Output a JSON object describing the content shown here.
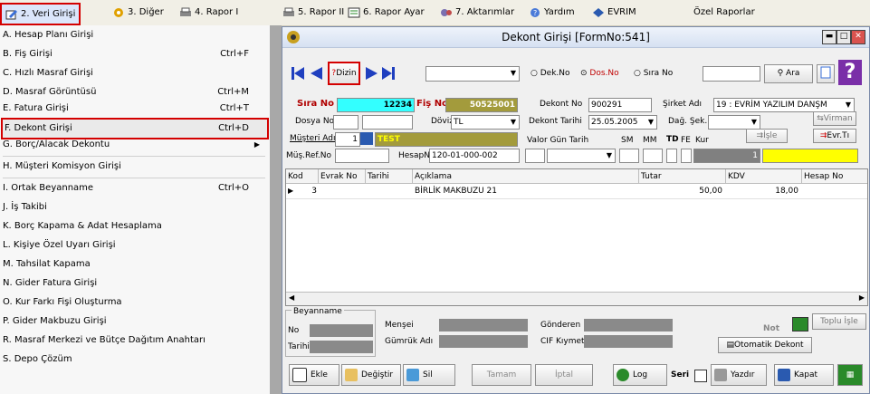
{
  "menubar": {
    "items": [
      {
        "label": "2. Veri Girişi"
      },
      {
        "label": "3. Diğer"
      },
      {
        "label": "4. Rapor I"
      },
      {
        "label": "5. Rapor II"
      },
      {
        "label": "6. Rapor Ayar"
      },
      {
        "label": "7. Aktarımlar"
      },
      {
        "label": "Yardım"
      },
      {
        "label": "EVRIM"
      },
      {
        "label": "Özel Raporlar"
      }
    ]
  },
  "dropdown": {
    "items": [
      {
        "label": "A. Hesap Planı Girişi",
        "shortcut": ""
      },
      {
        "label": "B. Fiş Girişi",
        "shortcut": "Ctrl+F"
      },
      {
        "label": "C. Hızlı Masraf Girişi",
        "shortcut": ""
      },
      {
        "label": "D. Masraf Görüntüsü",
        "shortcut": "Ctrl+M"
      },
      {
        "label": "E. Fatura Girişi",
        "shortcut": "Ctrl+T"
      },
      {
        "label": "F. Dekont Girişi",
        "shortcut": "Ctrl+D"
      },
      {
        "label": "G. Borç/Alacak Dekontu",
        "shortcut": ""
      },
      {
        "label": "H. Müşteri Komisyon Girişi",
        "shortcut": ""
      },
      {
        "label": "I. Ortak Beyanname",
        "shortcut": "Ctrl+O"
      },
      {
        "label": "J. İş Takibi",
        "shortcut": ""
      },
      {
        "label": "K. Borç Kapama & Adat Hesaplama",
        "shortcut": ""
      },
      {
        "label": "L. Kişiye Özel Uyarı Girişi",
        "shortcut": ""
      },
      {
        "label": "M. Tahsilat Kapama",
        "shortcut": ""
      },
      {
        "label": "N. Gider Fatura Girişi",
        "shortcut": ""
      },
      {
        "label": "O. Kur Farkı Fişi Oluşturma",
        "shortcut": ""
      },
      {
        "label": "P. Gider Makbuzu Girişi",
        "shortcut": ""
      },
      {
        "label": "R. Masraf Merkezi ve Bütçe Dağıtım Anahtarı",
        "shortcut": ""
      },
      {
        "label": "S. Depo Çözüm",
        "shortcut": ""
      }
    ]
  },
  "window": {
    "title": "Dekont Girişi [FormNo:541]",
    "toolbar": {
      "dizin_label": "Dizin",
      "dizin_prefix": "?",
      "radio_dek": "Dek.No",
      "radio_dos": "Dos.No",
      "radio_sira": "Sıra No",
      "ara_label": "Ara",
      "selected_radio": "Dos.No"
    },
    "form": {
      "sira_no_label": "Sıra No",
      "sira_no_value": "12234",
      "fis_no_label": "Fiş No",
      "fis_no_value": "50525001",
      "dekont_no_label": "Dekont No",
      "dekont_no_value": "900291",
      "sirket_adi_label": "Şirket Adı",
      "sirket_adi_value": "19 : EVRİM YAZILIM DANŞM",
      "dosya_no_label": "Dosya No",
      "doviz_label": "Döviz",
      "doviz_value": "TL",
      "dekont_tarihi_label": "Dekont Tarihi",
      "dekont_tarihi_value": "25.05.2005",
      "dag_sek_label": "Dağ. Şek.",
      "virman_label": "Virman",
      "musteri_adi_label": "Müşteri Adı",
      "musteri_no_value": "1",
      "musteri_name_value": "TEST",
      "valor_label": "Valor Gün Tarih",
      "sm_label": "SM",
      "mm_label": "MM",
      "td_label": "TD",
      "fe_label": "FE",
      "kur_label": "Kur",
      "kur_value": "1",
      "isle_label": "İşle",
      "evr_label": "Evr.Tı",
      "mus_ref_label": "Müş.Ref.No",
      "hesap_no_label": "HesapNo",
      "hesap_no_value": "120-01-000-002"
    },
    "grid": {
      "headers": [
        "Kod",
        "Evrak No",
        "Tarihi",
        "Açıklama",
        "Tutar",
        "KDV",
        "Hesap No"
      ],
      "rows": [
        {
          "kod": "3",
          "evrak_no": "",
          "tarihi": "",
          "aciklama": "BİRLİK MAKBUZU 21",
          "tutar": "50,00",
          "kdv": "18,00",
          "hesap_no": ""
        }
      ]
    },
    "bottom": {
      "beyanname_label": "Beyanname",
      "no_label": "No",
      "tarihi_label": "Tarihi",
      "mensei_label": "Menşei",
      "gumruk_label": "Gümrük Adı",
      "gonderen_label": "Gönderen",
      "cif_label": "CIF Kıymet",
      "not_label": "Not",
      "toplu_isle_label": "Toplu İşle",
      "otomatik_label": "Otomatik Dekont"
    },
    "footer": {
      "ekle": "Ekle",
      "degistir": "Değiştir",
      "sil": "Sil",
      "tamam": "Tamam",
      "iptal": "İptal",
      "log": "Log",
      "seri": "Seri",
      "yazdir": "Yazdır",
      "kapat": "Kapat"
    }
  },
  "colors": {
    "highlight_red": "#d40000",
    "sira_bg": "#33ffff",
    "fis_bg": "#a39b3c",
    "test_bg": "#a39b3c",
    "kur_bg": "#808080",
    "yellow": "#ffff00"
  }
}
